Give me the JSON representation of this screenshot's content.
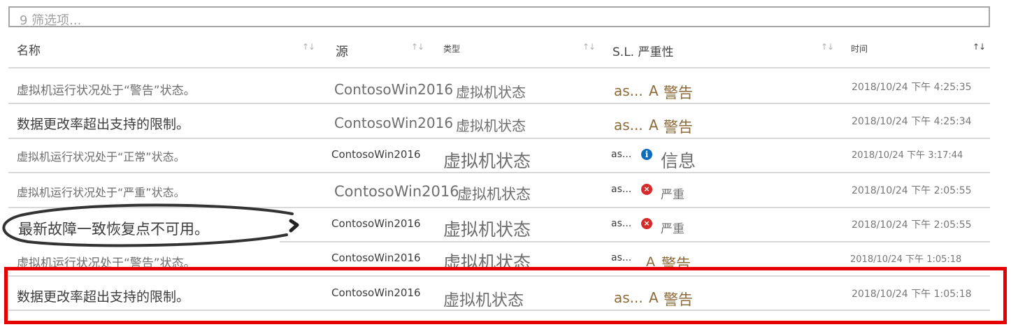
{
  "filter": {
    "placeholder": "9 筛选项..."
  },
  "columns": {
    "name": "名称",
    "source": "源",
    "type": "类型",
    "severity": "S.L. 严重性",
    "time": "时间"
  },
  "sort_icons": {
    "unsorted": "↑↓",
    "sorted_desc": "↑↓"
  },
  "rows": [
    {
      "name": "虚拟机运行状况处于“警告”状态。",
      "source": "ContosoWin2016",
      "type": "虚拟机状态",
      "sl": "as...",
      "severity_prefix": "A",
      "severity": "警告",
      "time": "2018/10/24 下午 4:25:35"
    },
    {
      "name": "数据更改率超出支持的限制。",
      "source": "ContosoWin2016",
      "type": "虚拟机状态",
      "sl": "as...",
      "severity_prefix": "A",
      "severity": "警告",
      "time": "2018/10/24 下午 4:25:34"
    },
    {
      "name": "虚拟机运行状况处于“正常”状态。",
      "source": "ContosoWin2016",
      "type": "虚拟机状态",
      "sl": "as...",
      "severity_icon": "i",
      "severity": "信息",
      "time": "2018/10/24 下午 3:17:44"
    },
    {
      "name": "虚拟机运行状况处于“严重”状态。",
      "source": "ContosoWin2016",
      "type": "虚拟机状态",
      "sl": "as...",
      "severity_icon": "×",
      "severity": "严重",
      "time": "2018/10/24 下午 2:05:55"
    },
    {
      "name": "最新故障一致恢复点不可用。",
      "source": "ContosoWin2016",
      "type": "虚拟机状态",
      "sl": "as...",
      "severity_icon": "×",
      "severity": "严重",
      "time": "2018/10/24 下午 2:05:55"
    },
    {
      "name": "虚拟机运行状况处于“警告”状态。",
      "source": "ContosoWin2016",
      "type": "虚拟机状态",
      "sl": "as...",
      "severity_prefix": "A",
      "severity": "警告",
      "time": "2018/10/24 下午 1:05:18"
    },
    {
      "name": "数据更改率超出支持的限制。",
      "source": "ContosoWin2016",
      "type": "虚拟机状态",
      "sl": "as...",
      "severity_prefix": "A",
      "severity": "警告",
      "time": "2018/10/24 下午 1:05:18"
    }
  ],
  "annotation": {
    "arrow_glyph": "›",
    "ellipse_color": "#333333",
    "highlight_color": "#e60000"
  },
  "colors": {
    "info": "#0f6cbd",
    "error": "#d62b2b",
    "warning_text": "#8d6a3a"
  }
}
